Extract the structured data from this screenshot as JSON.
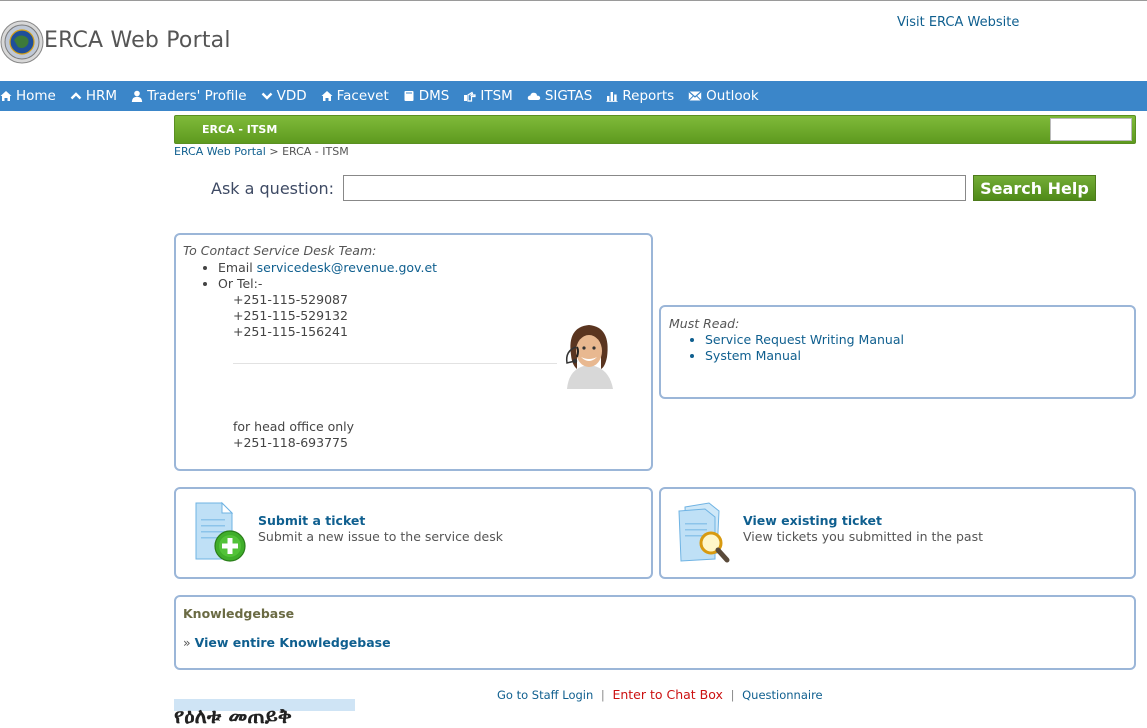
{
  "header": {
    "site_title": "ERCA Web Portal",
    "visit_link": "Visit ERCA Website"
  },
  "nav": {
    "items": [
      {
        "label": "Home",
        "icon": "home-icon"
      },
      {
        "label": "HRM",
        "icon": "chevron-up-icon"
      },
      {
        "label": "Traders' Profile",
        "icon": "user-icon"
      },
      {
        "label": "VDD",
        "icon": "chevron-down-icon"
      },
      {
        "label": "Facevet",
        "icon": "home-icon"
      },
      {
        "label": "DMS",
        "icon": "book-icon"
      },
      {
        "label": "ITSM",
        "icon": "hand-icon"
      },
      {
        "label": "SIGTAS",
        "icon": "cloud-icon"
      },
      {
        "label": "Reports",
        "icon": "bar-chart-icon"
      },
      {
        "label": "Outlook",
        "icon": "envelope-icon"
      }
    ]
  },
  "section_bar": {
    "title": "ERCA - ITSM"
  },
  "breadcrumb": {
    "root": "ERCA Web Portal",
    "separator": ">",
    "current": "ERCA - ITSM"
  },
  "search": {
    "label": "Ask a question:",
    "value": "",
    "button": "Search Help"
  },
  "contact": {
    "caption": "To Contact Service Desk Team:",
    "email_prefix": "Email",
    "email": "servicedesk@revenue.gov.et",
    "tel_label": "Or Tel:-",
    "phones": [
      "+251-115-529087",
      "+251-115-529132",
      "+251-115-156241"
    ],
    "head_office_label": "for head office only",
    "head_office_phone": "+251-118-693775"
  },
  "must_read": {
    "caption": "Must Read:",
    "items": [
      "Service Request Writing Manual",
      "System Manual"
    ]
  },
  "tickets": {
    "submit": {
      "title": "Submit a ticket",
      "description": "Submit a new issue to the service desk"
    },
    "view": {
      "title": "View existing ticket",
      "description": "View tickets you submitted in the past"
    }
  },
  "knowledgebase": {
    "title": "Knowledgebase",
    "bullet": "»",
    "link": "View entire Knowledgebase"
  },
  "footer": {
    "staff_login": "Go to Staff Login",
    "chat": "Enter to Chat Box",
    "questionnaire": "Questionnaire",
    "separator": "|"
  },
  "amharic_heading": "የዕለቱ መጠይቅ",
  "colors": {
    "nav_bg": "#3b86c9",
    "green_bar": "#6aa82a",
    "panel_border": "#9bb6d8",
    "link": "#0f5f8f",
    "chat_link": "#cc1111"
  }
}
